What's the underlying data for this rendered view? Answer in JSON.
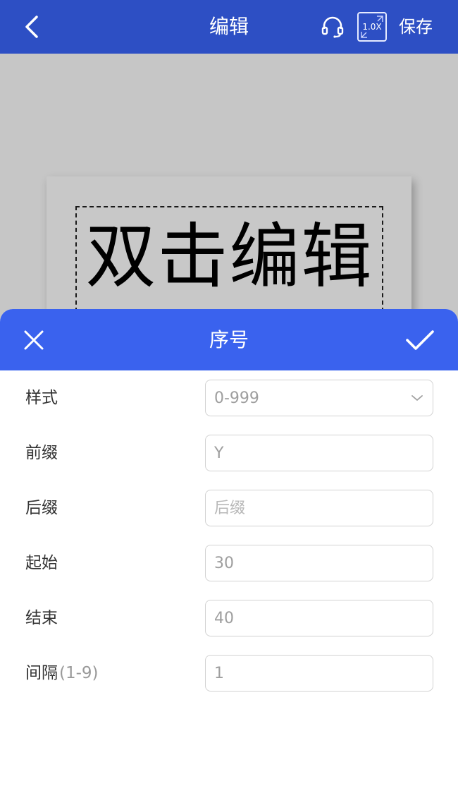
{
  "app_bar": {
    "title": "编辑",
    "back_icon": "chevron-left-icon",
    "support_icon": "headset-icon",
    "zoom_level": "1.0X",
    "save_label": "保存",
    "background": "#2d4fc4"
  },
  "canvas": {
    "background": "#c6c6c6",
    "text_element": "双击编辑"
  },
  "sheet": {
    "title": "序号",
    "close_icon": "close-icon",
    "confirm_icon": "checkmark-icon",
    "header_background": "#3a62ee",
    "fields": {
      "style": {
        "label": "样式",
        "value": "0-999"
      },
      "prefix": {
        "label": "前缀",
        "value": "Y"
      },
      "suffix": {
        "label": "后缀",
        "value": "",
        "placeholder": "后缀"
      },
      "start": {
        "label": "起始",
        "value": "30"
      },
      "end": {
        "label": "结束",
        "value": "40"
      },
      "interval": {
        "label": "间隔",
        "hint": "(1-9)",
        "value": "1"
      }
    }
  }
}
